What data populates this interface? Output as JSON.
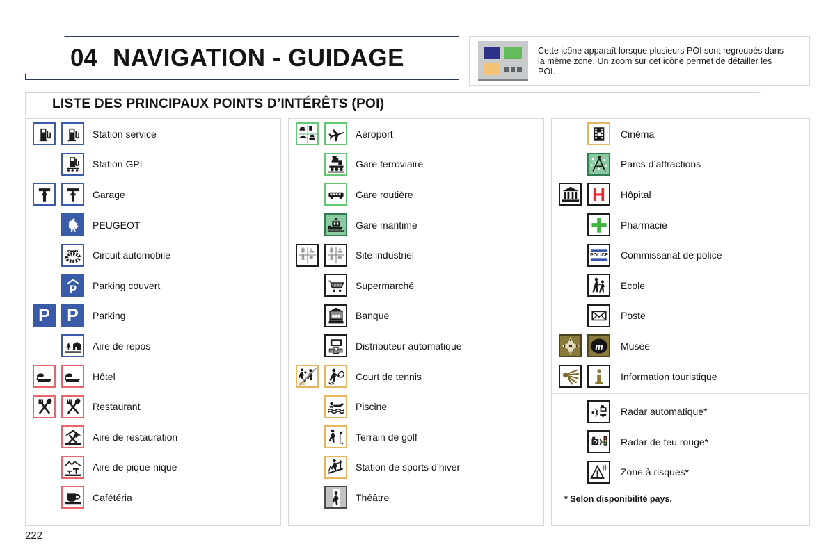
{
  "page": {
    "number": "222"
  },
  "header": {
    "chapter_number": "04",
    "chapter_title": "NAVIGATION - GUIDAGE",
    "info_icon": "poi-cluster-icon",
    "info_text": "Cette icône apparaît lorsque plusieurs POI sont regroupés dans la même zone. Un zoom sur cet icône permet de détailler les POI.",
    "colors": {
      "cluster_blue": "#2d3288",
      "cluster_green": "#63bb5c",
      "cluster_orange": "#f3c375",
      "cluster_background": "#c9cacb",
      "banner_border": "#2b3a5c"
    }
  },
  "section": {
    "title": "LISTE DES PRINCIPAUX POINTS D’INTÉRÊTS (POI)"
  },
  "columns": [
    {
      "id": "column-1",
      "items": [
        {
          "label": "Station service",
          "map_icon": "fuel-pump-icon",
          "list_icon": "fuel-pump-icon",
          "border": "blue"
        },
        {
          "label": "Station GPL",
          "map_icon": null,
          "list_icon": "lpg-pump-icon",
          "border": "blue"
        },
        {
          "label": "Garage",
          "map_icon": "wrench-icon",
          "list_icon": "wrench-icon",
          "border": "blue"
        },
        {
          "label": "PEUGEOT",
          "map_icon": null,
          "list_icon": "peugeot-lion-icon",
          "border": "blue-filled"
        },
        {
          "label": "Circuit automobile",
          "map_icon": null,
          "list_icon": "race-circuit-icon",
          "border": "blue"
        },
        {
          "label": "Parking couvert",
          "map_icon": null,
          "list_icon": "covered-parking-icon",
          "border": "blue-filled"
        },
        {
          "label": "Parking",
          "map_icon": "parking-p-icon",
          "list_icon": "parking-p-icon",
          "border": "blue-filled"
        },
        {
          "label": "Aire de repos",
          "map_icon": null,
          "list_icon": "rest-area-icon",
          "border": "blue"
        },
        {
          "label": "Hôtel",
          "map_icon": "bed-icon",
          "list_icon": "bed-icon",
          "border": "red"
        },
        {
          "label": "Restaurant",
          "map_icon": "fork-spoon-icon",
          "list_icon": "fork-spoon-icon",
          "border": "red"
        },
        {
          "label": "Aire de restauration",
          "map_icon": null,
          "list_icon": "roadside-diner-icon",
          "border": "red"
        },
        {
          "label": "Aire de pique-nique",
          "map_icon": null,
          "list_icon": "picnic-table-icon",
          "border": "red"
        },
        {
          "label": "Cafétéria",
          "map_icon": null,
          "list_icon": "coffee-cup-icon",
          "border": "red"
        }
      ]
    },
    {
      "id": "column-2",
      "items": [
        {
          "label": "Aéroport",
          "map_icon": "transport-cluster-icon",
          "list_icon": "airplane-icon",
          "border": "green"
        },
        {
          "label": "Gare ferroviaire",
          "map_icon": null,
          "list_icon": "train-icon",
          "border": "green"
        },
        {
          "label": "Gare routière",
          "map_icon": null,
          "list_icon": "bus-icon",
          "border": "green"
        },
        {
          "label": "Gare maritime",
          "map_icon": null,
          "list_icon": "ferry-terminal-icon",
          "border": "green-filled"
        },
        {
          "label": "Site industriel",
          "map_icon": "industry-cluster-icon",
          "list_icon": "industry-cluster-icon",
          "border": "black"
        },
        {
          "label": "Supermarché",
          "map_icon": null,
          "list_icon": "shopping-cart-icon",
          "border": "black"
        },
        {
          "label": "Banque",
          "map_icon": null,
          "list_icon": "bank-icon",
          "border": "black"
        },
        {
          "label": "Distributeur automatique",
          "map_icon": null,
          "list_icon": "atm-icon",
          "border": "black"
        },
        {
          "label": "Court de tennis",
          "map_icon": "sports-cluster-icon",
          "list_icon": "tennis-player-icon",
          "border": "orange"
        },
        {
          "label": "Piscine",
          "map_icon": null,
          "list_icon": "swimmer-icon",
          "border": "orange"
        },
        {
          "label": "Terrain de golf",
          "map_icon": null,
          "list_icon": "golfer-icon",
          "border": "orange"
        },
        {
          "label": "Station de sports d’hiver",
          "map_icon": null,
          "list_icon": "skier-icon",
          "border": "orange"
        },
        {
          "label": "Théâtre",
          "map_icon": null,
          "list_icon": "theatre-icon",
          "border": "orange-filled"
        }
      ]
    },
    {
      "id": "column-3",
      "items": [
        {
          "label": "Cinéma",
          "map_icon": null,
          "list_icon": "film-reel-icon",
          "border": "orange"
        },
        {
          "label": "Parcs d’attractions",
          "map_icon": null,
          "list_icon": "amusement-park-icon",
          "border": "green-filled"
        },
        {
          "label": "Hôpital",
          "map_icon": "monument-icon",
          "list_icon": "hospital-h-icon",
          "border": "black"
        },
        {
          "label": "Pharmacie",
          "map_icon": null,
          "list_icon": "pharmacy-cross-icon",
          "border": "black"
        },
        {
          "label": "Commissariat de police",
          "map_icon": null,
          "list_icon": "police-sign-icon",
          "border": "black"
        },
        {
          "label": "Ecole",
          "map_icon": null,
          "list_icon": "school-children-icon",
          "border": "black"
        },
        {
          "label": "Poste",
          "map_icon": null,
          "list_icon": "envelope-icon",
          "border": "black"
        },
        {
          "label": "Musée",
          "map_icon": "compass-rose-icon",
          "list_icon": "museum-m-icon",
          "border": "gold-filled"
        },
        {
          "label": "Information touristique",
          "map_icon": "info-beacon-icon",
          "list_icon": "info-i-icon",
          "border": "gold"
        }
      ],
      "secondary_items": [
        {
          "label": "Radar automatique*",
          "map_icon": null,
          "list_icon": "speed-camera-icon",
          "border": "black"
        },
        {
          "label": "Radar de feu rouge*",
          "map_icon": null,
          "list_icon": "red-light-camera-icon",
          "border": "black"
        },
        {
          "label": "Zone à risques*",
          "map_icon": null,
          "list_icon": "risk-zone-icon",
          "border": "black"
        }
      ],
      "footnote": "* Selon disponibilité pays."
    }
  ]
}
